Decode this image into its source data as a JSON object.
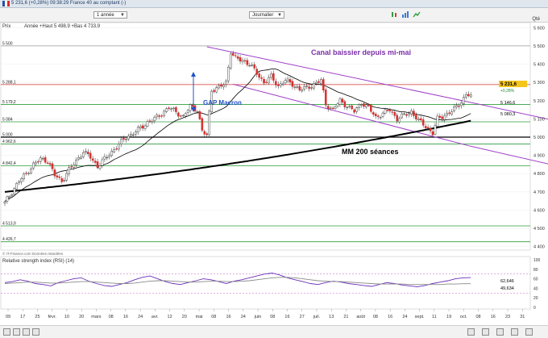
{
  "window": {
    "ticker_line": "5 231,6 (+0,28%)  09:38:29 France 40 au comptant (-)",
    "ticker_code": "PX1"
  },
  "toolbar": {
    "period": "1 année",
    "interval": "Journalier",
    "qty_label": "Qté"
  },
  "price_panel": {
    "header": "Prix",
    "info": "Année  +Haut 5 498,9  +Bas 4 733,9",
    "copyright": "© IT-Finance.com Données retardées",
    "current_value": "5 231,6",
    "current_change": "+0,28%",
    "ma_value_label": "5 146,6",
    "extra_value_label": "5 080,3"
  },
  "rsi_panel": {
    "header": "Relative strength index (RSI) (14)",
    "value_label": "62,646",
    "signal_label": "49,634",
    "y_ticks": [
      "100",
      "80",
      "60",
      "40",
      "20",
      "0"
    ]
  },
  "x_axis_labels": [
    "09",
    "17",
    "25",
    "févr.",
    "10",
    "20",
    "mars",
    "08",
    "16",
    "24",
    "avr.",
    "12",
    "20",
    "mai",
    "08",
    "16",
    "24",
    "juin",
    "08",
    "16",
    "27",
    "juil.",
    "13",
    "21",
    "août",
    "08",
    "16",
    "24",
    "sept.",
    "11",
    "19",
    "oct.",
    "08",
    "16",
    "23",
    "31"
  ],
  "chart_data": {
    "type": "candlestick",
    "title": "",
    "y_ticks": [
      5600,
      5500,
      5400,
      5300,
      5200,
      5100,
      5000,
      4900,
      4800,
      4700,
      4600,
      4500,
      4400
    ],
    "ylim": [
      4390,
      5610
    ],
    "horizontal_levels": [
      {
        "value": 5500,
        "label": "5 500",
        "color": "#9a9a9a"
      },
      {
        "value": 5288.1,
        "label": "5 288,1",
        "color": "#d9534f"
      },
      {
        "value": 5179.2,
        "label": "5 179,2",
        "color": "#2e9e3e"
      },
      {
        "value": 5084,
        "label": "5 084",
        "color": "#2e9e3e"
      },
      {
        "value": 5000,
        "label": "5 000",
        "color": "#000000"
      },
      {
        "value": 4962.6,
        "label": "4 962,6",
        "color": "#2e9e3e"
      },
      {
        "value": 4842.4,
        "label": "4 842,4",
        "color": "#2e9e3e"
      },
      {
        "value": 4513.9,
        "label": "4 513,9",
        "color": "#2e9e3e"
      },
      {
        "value": 4426.7,
        "label": "4 426,7",
        "color": "#2e9e3e"
      }
    ],
    "annotations": [
      {
        "text": "Canal baissier depuis mi-mai",
        "color": "#7b2fa8"
      },
      {
        "text": "GAP Macron",
        "color": "#2050c8"
      },
      {
        "text": "MM 200 séances",
        "color": "#000000"
      }
    ],
    "anchor_closes": [
      [
        0,
        4640
      ],
      [
        3,
        4700
      ],
      [
        6,
        4760
      ],
      [
        9,
        4800
      ],
      [
        12,
        4850
      ],
      [
        15,
        4880
      ],
      [
        18,
        4870
      ],
      [
        21,
        4790
      ],
      [
        24,
        4760
      ],
      [
        27,
        4820
      ],
      [
        30,
        4870
      ],
      [
        33,
        4920
      ],
      [
        36,
        4890
      ],
      [
        39,
        4840
      ],
      [
        42,
        4880
      ],
      [
        45,
        4920
      ],
      [
        48,
        4960
      ],
      [
        51,
        5000
      ],
      [
        54,
        5020
      ],
      [
        57,
        5050
      ],
      [
        60,
        5080
      ],
      [
        63,
        5100
      ],
      [
        66,
        5130
      ],
      [
        69,
        5160
      ],
      [
        72,
        5140
      ],
      [
        75,
        5110
      ],
      [
        78,
        5170
      ],
      [
        81,
        5150
      ],
      [
        83,
        5030
      ],
      [
        85,
        5010
      ],
      [
        87,
        5260
      ],
      [
        90,
        5270
      ],
      [
        93,
        5300
      ],
      [
        95,
        5470
      ],
      [
        97,
        5430
      ],
      [
        100,
        5420
      ],
      [
        103,
        5400
      ],
      [
        106,
        5350
      ],
      [
        109,
        5300
      ],
      [
        112,
        5330
      ],
      [
        115,
        5280
      ],
      [
        118,
        5310
      ],
      [
        121,
        5290
      ],
      [
        124,
        5260
      ],
      [
        127,
        5270
      ],
      [
        130,
        5290
      ],
      [
        133,
        5310
      ],
      [
        135,
        5180
      ],
      [
        138,
        5150
      ],
      [
        141,
        5200
      ],
      [
        144,
        5170
      ],
      [
        147,
        5140
      ],
      [
        150,
        5190
      ],
      [
        153,
        5160
      ],
      [
        156,
        5110
      ],
      [
        159,
        5130
      ],
      [
        162,
        5150
      ],
      [
        165,
        5100
      ],
      [
        168,
        5120
      ],
      [
        171,
        5140
      ],
      [
        174,
        5090
      ],
      [
        177,
        5060
      ],
      [
        180,
        5020
      ],
      [
        182,
        5100
      ],
      [
        185,
        5120
      ],
      [
        188,
        5140
      ],
      [
        191,
        5180
      ],
      [
        194,
        5230
      ],
      [
        196,
        5231.6
      ]
    ],
    "moving_average_200": {
      "start": 4700,
      "end": 5090,
      "color": "#000000"
    },
    "moving_average_short": {
      "color": "#000000"
    },
    "channel": {
      "color": "#a040c8",
      "upper": [
        [
          85,
          5495
        ],
        [
          196,
          5190
        ],
        [
          260,
          5010
        ]
      ],
      "lower": [
        [
          96,
          5290
        ],
        [
          196,
          4950
        ],
        [
          260,
          4760
        ]
      ]
    },
    "rsi": {
      "type": "line",
      "ylim": [
        0,
        100
      ],
      "series": [
        {
          "name": "RSI",
          "color": "#6a2fb8",
          "values": [
            52,
            54,
            58,
            55,
            50,
            48,
            45,
            52,
            56,
            60,
            62,
            55,
            50,
            46,
            44,
            48,
            52,
            58,
            63,
            66,
            60,
            54,
            50,
            48,
            52,
            56,
            60,
            58,
            54,
            50,
            55,
            58,
            62,
            66,
            70,
            72,
            68,
            62,
            58,
            54,
            50,
            48,
            52,
            55,
            53,
            50,
            48,
            46,
            44,
            48,
            52,
            50,
            47,
            45,
            43,
            46,
            50,
            53,
            56,
            60,
            62,
            62.6
          ]
        },
        {
          "name": "Signal",
          "color": "#8a8a8a",
          "values": [
            50,
            51,
            52,
            53,
            53,
            52,
            51,
            51,
            52,
            53,
            54,
            54,
            53,
            52,
            51,
            50,
            50,
            51,
            53,
            55,
            56,
            56,
            55,
            54,
            53,
            53,
            54,
            55,
            55,
            54,
            54,
            55,
            56,
            58,
            60,
            62,
            63,
            63,
            62,
            60,
            58,
            56,
            55,
            54,
            54,
            53,
            52,
            51,
            50,
            49,
            49,
            49,
            49,
            48,
            48,
            48,
            48,
            48,
            49,
            49,
            49.6,
            49.6
          ]
        }
      ],
      "levels": [
        70,
        30
      ]
    }
  }
}
